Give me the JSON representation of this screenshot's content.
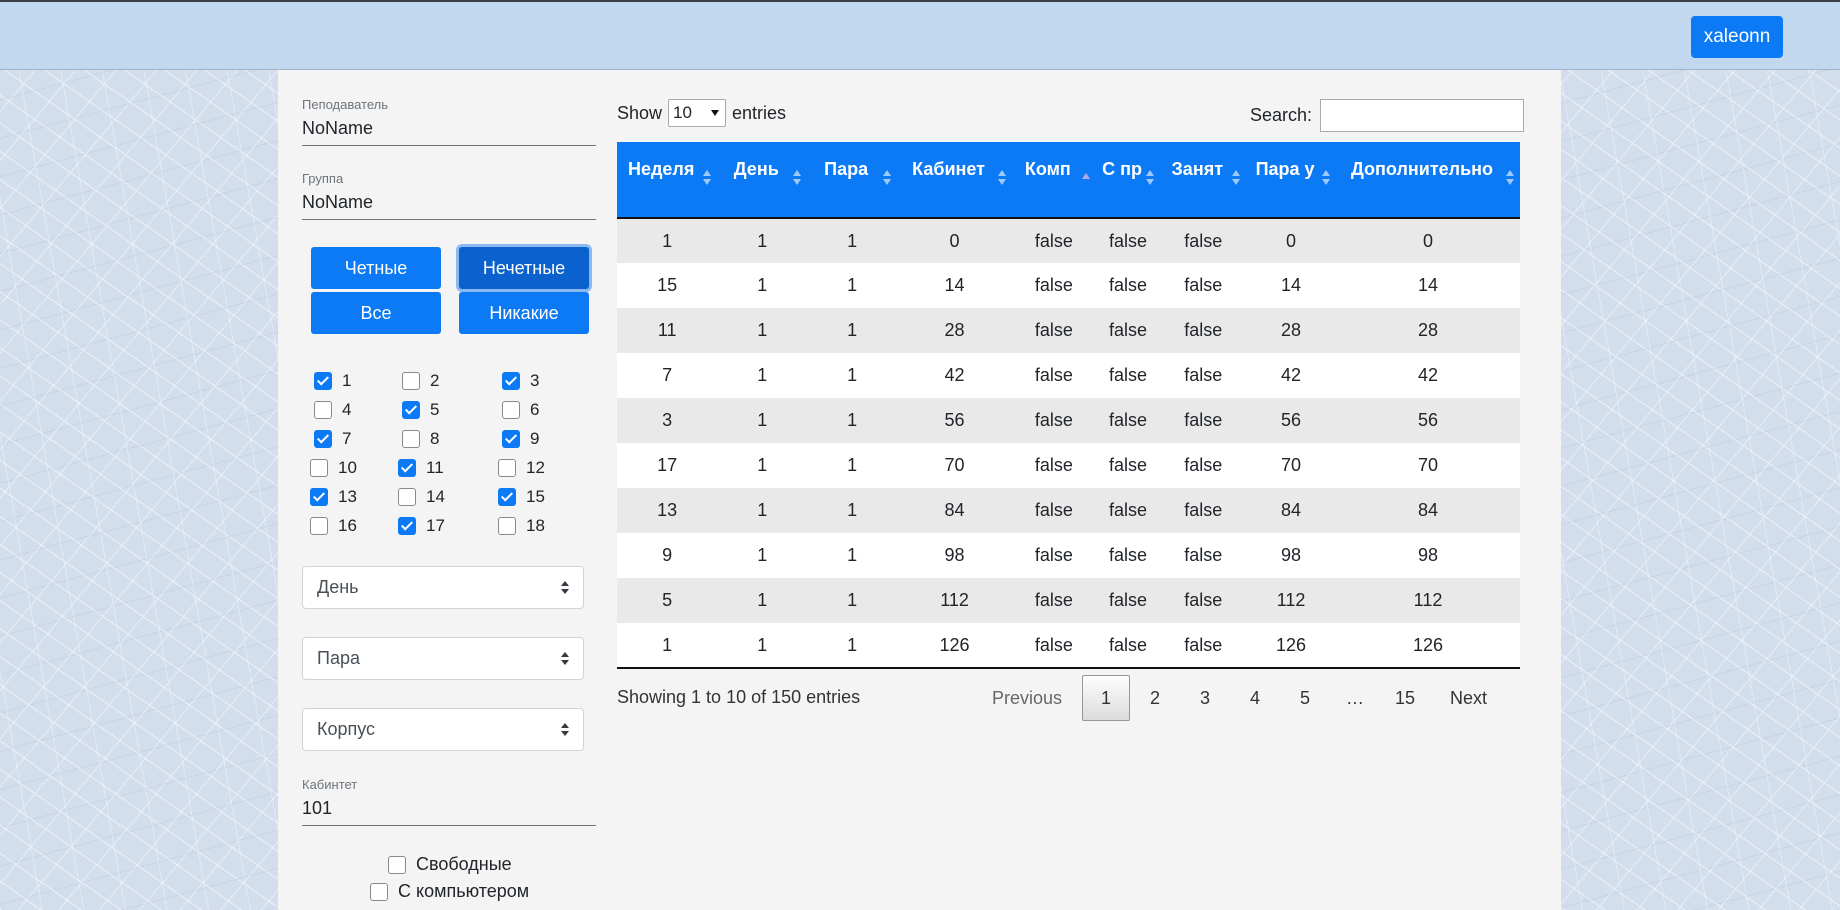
{
  "header": {
    "user_button": "xaleonn"
  },
  "sidebar": {
    "teacher_label": "Пеподаватель",
    "teacher_value": "NoName",
    "group_label": "Группа",
    "group_value": "NoName",
    "buttons": {
      "even": "Четные",
      "odd": "Нечетные",
      "all": "Все",
      "none": "Никакие"
    },
    "weeks": [
      {
        "n": "1",
        "checked": true
      },
      {
        "n": "2",
        "checked": false
      },
      {
        "n": "3",
        "checked": true
      },
      {
        "n": "4",
        "checked": false
      },
      {
        "n": "5",
        "checked": true
      },
      {
        "n": "6",
        "checked": false
      },
      {
        "n": "7",
        "checked": true
      },
      {
        "n": "8",
        "checked": false
      },
      {
        "n": "9",
        "checked": true
      },
      {
        "n": "10",
        "checked": false
      },
      {
        "n": "11",
        "checked": true
      },
      {
        "n": "12",
        "checked": false
      },
      {
        "n": "13",
        "checked": true
      },
      {
        "n": "14",
        "checked": false
      },
      {
        "n": "15",
        "checked": true
      },
      {
        "n": "16",
        "checked": false
      },
      {
        "n": "17",
        "checked": true
      },
      {
        "n": "18",
        "checked": false
      }
    ],
    "select_day": "День",
    "select_pair": "Пара",
    "select_building": "Корпус",
    "room_label": "Кабинтет",
    "room_value": "101",
    "free_label": "Свободные",
    "computer_label": "С компьютером"
  },
  "table_controls": {
    "show": "Show",
    "length": "10",
    "entries": "entries",
    "search_label": "Search:",
    "search_value": ""
  },
  "table": {
    "columns": [
      "Неделя",
      "День",
      "Пара",
      "Кабинет",
      "Комп",
      "С пр",
      "Занят",
      "Пара у",
      "Дополнительно"
    ],
    "rows": [
      [
        "1",
        "1",
        "1",
        "0",
        "false",
        "false",
        "false",
        "0",
        "0"
      ],
      [
        "15",
        "1",
        "1",
        "14",
        "false",
        "false",
        "false",
        "14",
        "14"
      ],
      [
        "11",
        "1",
        "1",
        "28",
        "false",
        "false",
        "false",
        "28",
        "28"
      ],
      [
        "7",
        "1",
        "1",
        "42",
        "false",
        "false",
        "false",
        "42",
        "42"
      ],
      [
        "3",
        "1",
        "1",
        "56",
        "false",
        "false",
        "false",
        "56",
        "56"
      ],
      [
        "17",
        "1",
        "1",
        "70",
        "false",
        "false",
        "false",
        "70",
        "70"
      ],
      [
        "13",
        "1",
        "1",
        "84",
        "false",
        "false",
        "false",
        "84",
        "84"
      ],
      [
        "9",
        "1",
        "1",
        "98",
        "false",
        "false",
        "false",
        "98",
        "98"
      ],
      [
        "5",
        "1",
        "1",
        "112",
        "false",
        "false",
        "false",
        "112",
        "112"
      ],
      [
        "1",
        "1",
        "1",
        "126",
        "false",
        "false",
        "false",
        "126",
        "126"
      ]
    ]
  },
  "footer": {
    "info": "Showing 1 to 10 of 150 entries",
    "previous": "Previous",
    "pages": [
      "1",
      "2",
      "3",
      "4",
      "5",
      "…",
      "15"
    ],
    "current_page": "1",
    "next": "Next"
  },
  "colors": {
    "accent": "#0d7af5",
    "topbar": "#c2d8ee",
    "panel": "#f4f4f4"
  }
}
